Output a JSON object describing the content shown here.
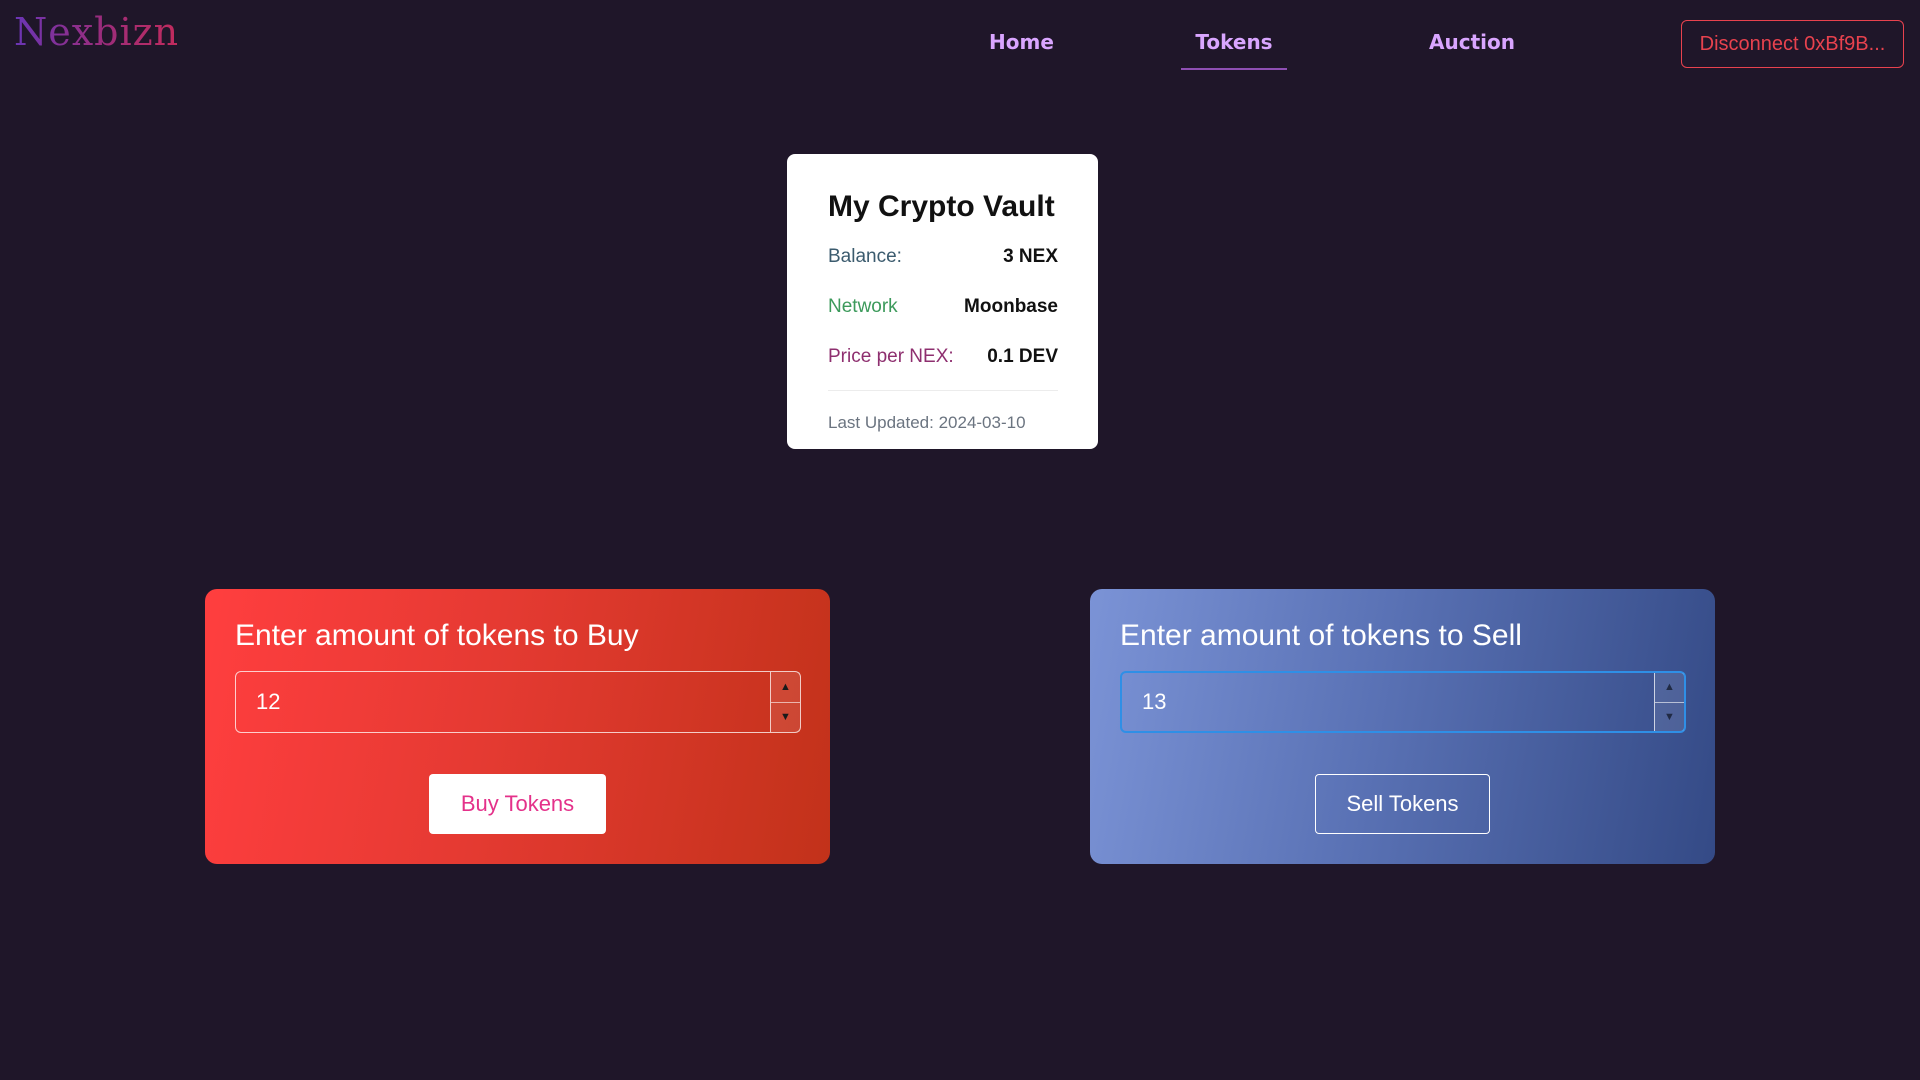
{
  "header": {
    "logo_text": "Nexbizn",
    "nav": {
      "home": "Home",
      "tokens": "Tokens",
      "auction": "Auction"
    },
    "disconnect_label": "Disconnect 0xBf9B...",
    "active_tab": "Tokens"
  },
  "vault": {
    "title": "My Crypto Vault",
    "balance_label": "Balance:",
    "balance_value": "3 NEX",
    "network_label": "Network",
    "network_value": "Moonbase",
    "price_label": "Price per NEX:",
    "price_value": "0.1 DEV",
    "last_updated": "Last Updated: 2024-03-10"
  },
  "buy_panel": {
    "title": "Enter amount of tokens to Buy",
    "amount": "12",
    "button_label": "Buy Tokens"
  },
  "sell_panel": {
    "title": "Enter amount of tokens to Sell",
    "amount": "13",
    "button_label": "Sell Tokens"
  },
  "colors": {
    "background": "#1f1629",
    "nav_link": "#d9a5ff",
    "disconnect": "#e8424e",
    "buy_accent": "#e4318a",
    "focus_ring": "#2f8fe6"
  },
  "icons": [
    "spin-up-icon",
    "spin-down-icon"
  ]
}
